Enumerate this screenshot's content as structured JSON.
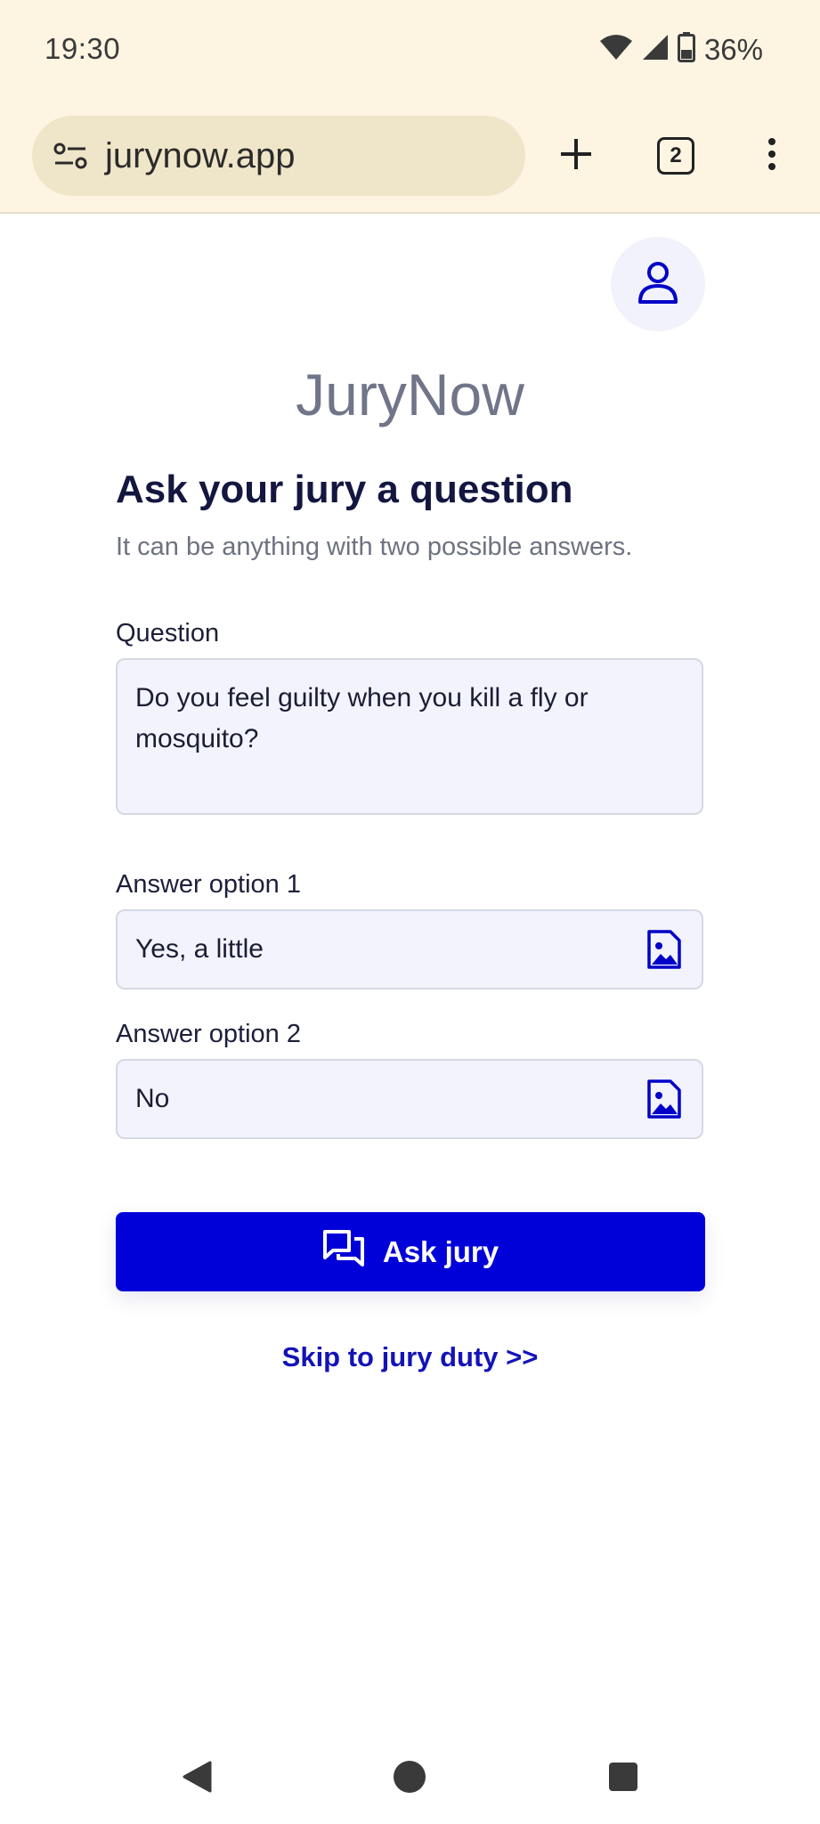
{
  "status_bar": {
    "time": "19:30",
    "battery": "36%",
    "icons": [
      "wifi-icon",
      "signal-icon",
      "battery-icon"
    ]
  },
  "browser": {
    "url": "jurynow.app",
    "tab_count": "2",
    "icons": [
      "tune-icon",
      "plus-icon",
      "tabs-icon",
      "more-vert-icon"
    ]
  },
  "app": {
    "brand": "JuryNow",
    "heading": "Ask your jury a question",
    "subheading": "It can be anything with two possible answers.",
    "question_label": "Question",
    "question_value": "Do you feel guilty when you kill a fly or mosquito?",
    "answer1_label": "Answer option 1",
    "answer1_value": "Yes, a little",
    "answer2_label": "Answer option 2",
    "answer2_value": "No",
    "ask_button": "Ask jury",
    "skip_link": "Skip to jury duty >>"
  },
  "colors": {
    "accent": "#0000d8",
    "link": "#1313b8",
    "chrome_bg": "#fdf5e2",
    "field_bg": "#f2f3fd"
  }
}
